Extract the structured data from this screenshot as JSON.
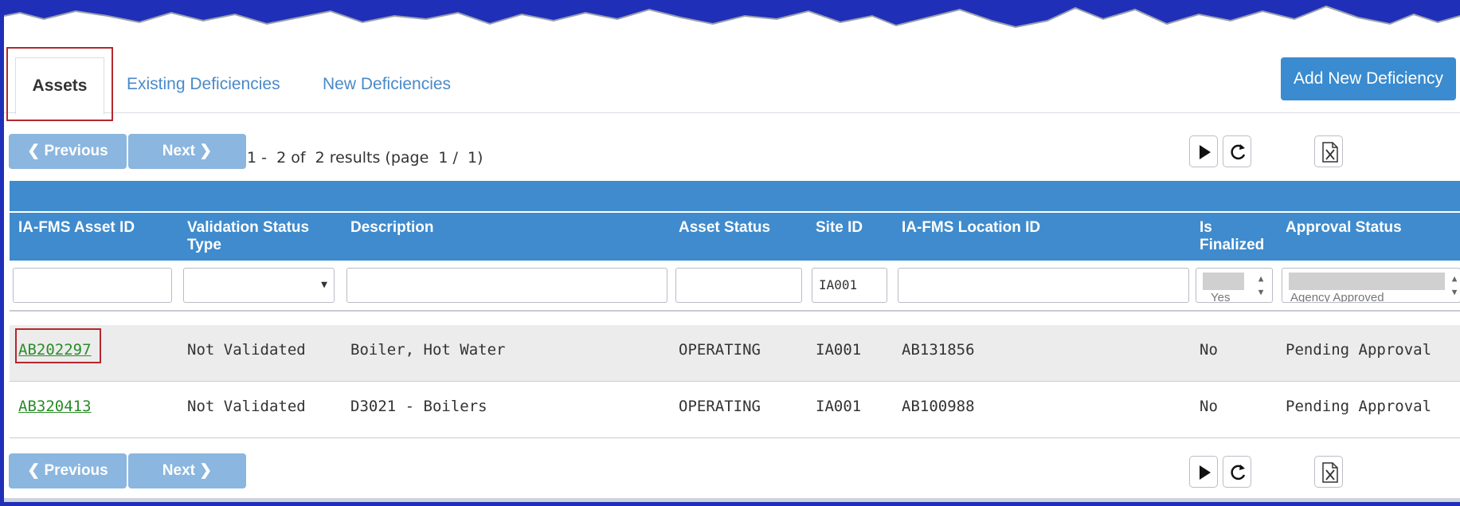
{
  "tabs": [
    {
      "label": "Assets",
      "active": true
    },
    {
      "label": "Existing Deficiencies",
      "active": false
    },
    {
      "label": "New Deficiencies",
      "active": false
    }
  ],
  "add_button_label": "Add New Deficiency",
  "pager": {
    "previous_label": "Previous",
    "next_label": "Next",
    "info": "1 -  2 of  2 results (page  1 /  1)"
  },
  "toolbar_icons": [
    "play-icon",
    "refresh-icon",
    "excel-export-icon"
  ],
  "columns": [
    {
      "line1": "IA-FMS Asset ID",
      "line2": ""
    },
    {
      "line1": "Validation Status",
      "line2": "Type"
    },
    {
      "line1": "Description",
      "line2": ""
    },
    {
      "line1": "Asset Status",
      "line2": ""
    },
    {
      "line1": "Site ID",
      "line2": ""
    },
    {
      "line1": "IA-FMS Location ID",
      "line2": ""
    },
    {
      "line1": "Is",
      "line2": "Finalized"
    },
    {
      "line1": "Approval Status",
      "line2": ""
    }
  ],
  "filters": {
    "site_id": "IA001",
    "is_finalized_option": "Yes",
    "approval_status_option": "Agency Approved"
  },
  "rows": [
    {
      "asset_id": "AB202297",
      "validation": "Not Validated",
      "description": "Boiler, Hot Water",
      "asset_status": "OPERATING",
      "site_id": "IA001",
      "location_id": "AB131856",
      "is_finalized": "No",
      "approval": "Pending Approval"
    },
    {
      "asset_id": "AB320413",
      "validation": "Not Validated",
      "description": "D3021 - Boilers",
      "asset_status": "OPERATING",
      "site_id": "IA001",
      "location_id": "AB100988",
      "is_finalized": "No",
      "approval": "Pending Approval"
    }
  ],
  "colors": {
    "header": "#3f8bcd",
    "link": "#2a8c2a",
    "highlight": "#b3282d",
    "pager_button": "#8ab6df"
  }
}
